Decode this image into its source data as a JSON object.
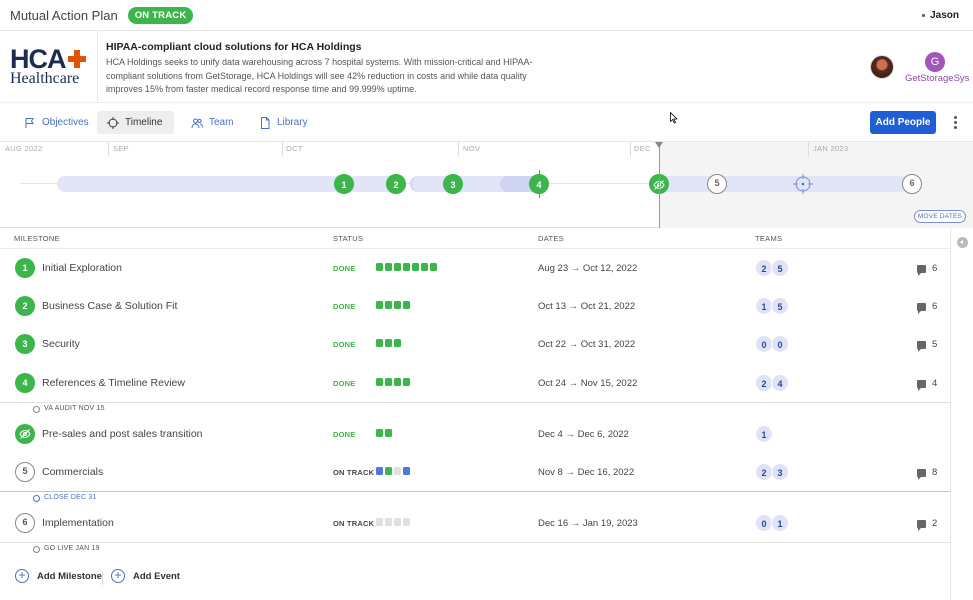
{
  "app": {
    "title": "Mutual Action Plan",
    "plan_status": "ON TRACK",
    "user": "Jason"
  },
  "header": {
    "logo": {
      "top": "HCA",
      "bottom": "Healthcare"
    },
    "title": "HIPAA-compliant cloud solutions for HCA Holdings",
    "description": "HCA Holdings seeks to unify data warehousing across 7 hospital systems. With mission-critical and HIPAA-compliant solutions from GetStorage, HCA Holdings will see 42% reduction in costs and while data quality improves 15% from faster medical record response time and 99.999% uptime.",
    "vendor_avatar_letter": "G",
    "vendor_name": "GetStorageSys"
  },
  "tabs": [
    {
      "label": "Objectives",
      "icon": "flag-icon"
    },
    {
      "label": "Timeline",
      "icon": "crosshair-icon",
      "active": true
    },
    {
      "label": "Team",
      "icon": "team-icon"
    },
    {
      "label": "Library",
      "icon": "document-icon"
    }
  ],
  "actions": {
    "add_people": "Add People"
  },
  "timeline": {
    "months": [
      "AUG 2022",
      "SEP",
      "OCT",
      "NOV",
      "DEC",
      "JAN 2023"
    ],
    "nodes": [
      "1",
      "2",
      "3",
      "4",
      "5",
      "6"
    ],
    "move_dates": "MOVE DATES"
  },
  "table": {
    "headers": {
      "milestone": "MILESTONE",
      "status": "STATUS",
      "dates": "DATES",
      "teams": "TEAMS"
    },
    "rows": [
      {
        "num": "1",
        "name": "Initial Exploration",
        "status": "DONE",
        "dates": "Aug 23 → Oct 12, 2022",
        "teams": [
          "2",
          "5"
        ],
        "comments": "6"
      },
      {
        "num": "2",
        "name": "Business Case & Solution Fit",
        "status": "DONE",
        "dates": "Oct 13 → Oct 21, 2022",
        "teams": [
          "1",
          "5"
        ],
        "comments": "6"
      },
      {
        "num": "3",
        "name": "Security",
        "status": "DONE",
        "dates": "Oct 22 → Oct 31, 2022",
        "teams": [
          "0",
          "0"
        ],
        "comments": "5"
      },
      {
        "num": "4",
        "name": "References & Timeline Review",
        "status": "DONE",
        "dates": "Oct 24 → Nov 15, 2022",
        "teams": [
          "2",
          "4"
        ],
        "comments": "4"
      },
      {
        "num": "",
        "name": "Pre-sales and post sales transition",
        "status": "DONE",
        "dates": "Dec 4 → Dec 6, 2022",
        "teams": [
          "1"
        ],
        "comments": ""
      },
      {
        "num": "5",
        "name": "Commercials",
        "status": "ON TRACK",
        "dates": "Nov 8 → Dec 16, 2022",
        "teams": [
          "2",
          "3"
        ],
        "comments": "8"
      },
      {
        "num": "6",
        "name": "Implementation",
        "status": "ON TRACK",
        "dates": "Dec 16 → Jan 19, 2023",
        "teams": [
          "0",
          "1"
        ],
        "comments": "2"
      }
    ],
    "events": {
      "va_audit": "VA AUDIT NOV 15",
      "close": "CLOSE DEC 31",
      "go_live": "GO LIVE JAN 19"
    }
  },
  "footer": {
    "add_milestone": "Add Milestone",
    "add_event": "Add Event"
  },
  "colors": {
    "done": "#3cb54a",
    "on_track_bar": "#4f78d8",
    "primary": "#1e5fd6",
    "band": "#e2e5f7"
  }
}
